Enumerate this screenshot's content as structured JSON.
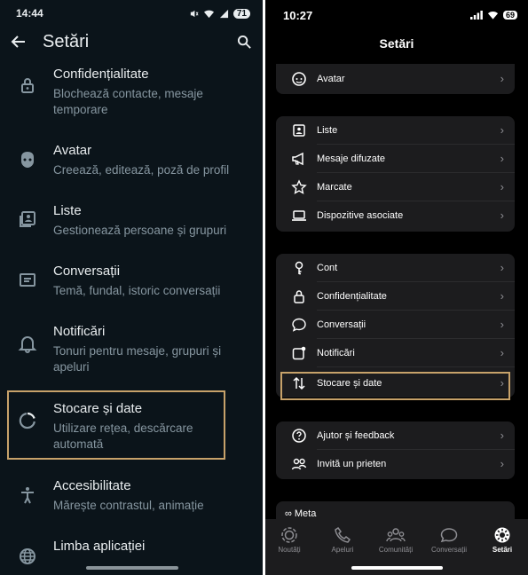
{
  "android": {
    "status": {
      "time": "14:44",
      "battery": "71"
    },
    "appbar": {
      "title": "Setări"
    },
    "items": [
      {
        "title": "Confidențialitate",
        "subtitle": "Blochează contacte, mesaje temporare",
        "icon": "lock-icon"
      },
      {
        "title": "Avatar",
        "subtitle": "Creează, editează, poză de profil",
        "icon": "avatar-icon"
      },
      {
        "title": "Liste",
        "subtitle": "Gestionează persoane și grupuri",
        "icon": "lists-icon"
      },
      {
        "title": "Conversații",
        "subtitle": "Temă, fundal, istoric conversații",
        "icon": "chat-icon"
      },
      {
        "title": "Notificări",
        "subtitle": "Tonuri pentru mesaje, grupuri și apeluri",
        "icon": "bell-icon"
      },
      {
        "title": "Stocare și date",
        "subtitle": "Utilizare rețea, descărcare automată",
        "icon": "storage-icon"
      },
      {
        "title": "Accesibilitate",
        "subtitle": "Mărește contrastul, animație",
        "icon": "accessibility-icon"
      },
      {
        "title": "Limba aplicației",
        "subtitle": "",
        "icon": "globe-icon"
      }
    ]
  },
  "ios": {
    "status": {
      "time": "10:27",
      "battery": "69"
    },
    "title": "Setări",
    "rows": {
      "avatar": "Avatar",
      "liste": "Liste",
      "mesaje_difuzate": "Mesaje difuzate",
      "marcate": "Marcate",
      "dispozitive": "Dispozitive asociate",
      "cont": "Cont",
      "confidentialitate": "Confidențialitate",
      "conversatii": "Conversații",
      "notificari": "Notificări",
      "stocare": "Stocare și date",
      "ajutor": "Ajutor și feedback",
      "invita": "Invită un prieten"
    },
    "meta": "∞ Meta",
    "tabs": {
      "noutati": "Noutăți",
      "apeluri": "Apeluri",
      "comunitati": "Comunități",
      "conversatii": "Conversații",
      "setari": "Setări"
    }
  },
  "colors": {
    "highlight": "#c7a26a",
    "android_bg": "#0b141a",
    "ios_bg": "#000000"
  }
}
